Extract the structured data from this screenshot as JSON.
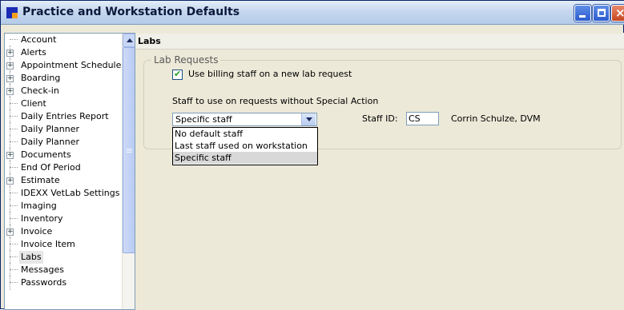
{
  "window": {
    "title": "Practice and Workstation Defaults",
    "minimize_label": "",
    "maximize_label": "",
    "close_label": "×"
  },
  "sidebar": {
    "items": [
      {
        "label": "Account",
        "expandable": false
      },
      {
        "label": "Alerts",
        "expandable": true
      },
      {
        "label": "Appointment Schedule",
        "expandable": true
      },
      {
        "label": "Boarding",
        "expandable": true
      },
      {
        "label": "Check-in",
        "expandable": true
      },
      {
        "label": "Client",
        "expandable": false
      },
      {
        "label": "Daily Entries Report",
        "expandable": false
      },
      {
        "label": "Daily Planner",
        "expandable": false
      },
      {
        "label": "Daily Planner",
        "expandable": false
      },
      {
        "label": "Documents",
        "expandable": true
      },
      {
        "label": "End Of Period",
        "expandable": false
      },
      {
        "label": "Estimate",
        "expandable": true
      },
      {
        "label": "IDEXX VetLab Settings",
        "expandable": false
      },
      {
        "label": "Imaging",
        "expandable": false
      },
      {
        "label": "Inventory",
        "expandable": false
      },
      {
        "label": "Invoice",
        "expandable": true
      },
      {
        "label": "Invoice Item",
        "expandable": false
      },
      {
        "label": "Labs",
        "expandable": false,
        "selected": true
      },
      {
        "label": "Messages",
        "expandable": false
      },
      {
        "label": "Passwords",
        "expandable": false
      }
    ]
  },
  "main": {
    "header": "Labs",
    "group": {
      "title": "Lab Requests",
      "checkbox_label": "Use billing staff on a new lab request",
      "checkbox_checked": true,
      "staff_label": "Staff to use on requests without Special Action",
      "selected_option": "Specific staff",
      "options": [
        "No default staff",
        "Last staff used on workstation",
        "Specific staff"
      ],
      "staff_id_label": "Staff ID:",
      "staff_id_value": "CS",
      "staff_name": "Corrin Schulze, DVM"
    }
  },
  "colors": {
    "titlebar": "#c6d7ef",
    "panel": "#ece9d8",
    "selection": "#d8d8d8",
    "checkmark": "#21a121"
  }
}
